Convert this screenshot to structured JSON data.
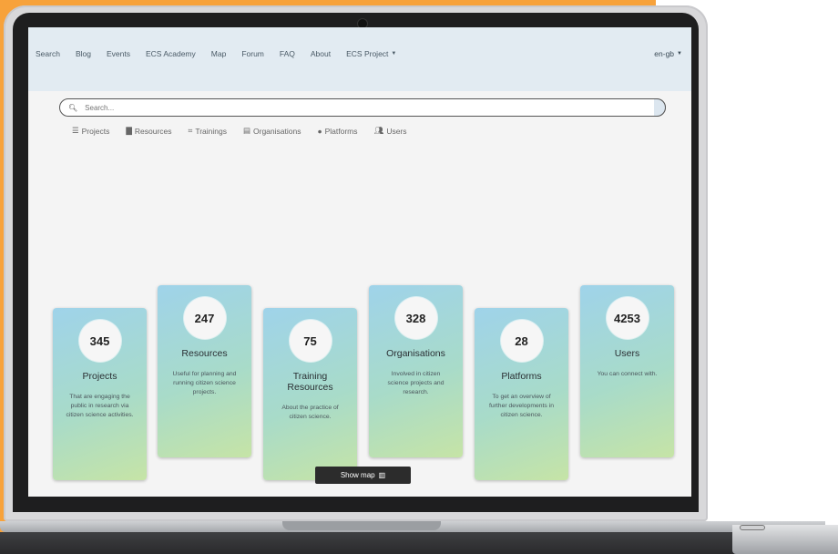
{
  "topnav": {
    "items": [
      "Search",
      "Blog",
      "Events",
      "ECS Academy",
      "Map",
      "Forum",
      "FAQ",
      "About",
      "ECS Project"
    ],
    "lang": "en-gb"
  },
  "search": {
    "placeholder": "Search..."
  },
  "tabs": [
    {
      "label": "Projects",
      "icon": "list-icon"
    },
    {
      "label": "Resources",
      "icon": "book-icon"
    },
    {
      "label": "Trainings",
      "icon": "chalkboard-icon"
    },
    {
      "label": "Organisations",
      "icon": "building-icon"
    },
    {
      "label": "Platforms",
      "icon": "globe-icon"
    },
    {
      "label": "Users",
      "icon": "users-icon"
    }
  ],
  "cards": [
    {
      "count": "345",
      "title": "Projects",
      "desc": "That are engaging the public in research via citizen science activities."
    },
    {
      "count": "247",
      "title": "Resources",
      "desc": "Useful for planning and running citizen science projects."
    },
    {
      "count": "75",
      "title": "Training Resources",
      "desc": "About the practice of citizen science."
    },
    {
      "count": "328",
      "title": "Organisations",
      "desc": "Involved in citizen science projects and research."
    },
    {
      "count": "28",
      "title": "Platforms",
      "desc": "To get an overview of further developments in citizen science."
    },
    {
      "count": "4253",
      "title": "Users",
      "desc": "You can connect with."
    }
  ],
  "show_map": {
    "label": "Show map"
  },
  "colors": {
    "accent_orange": "#f7a23b",
    "nav_bg": "#e2ebf2",
    "card_gradient_start": "#9fd3ea",
    "card_gradient_end": "#c6e4a6"
  }
}
